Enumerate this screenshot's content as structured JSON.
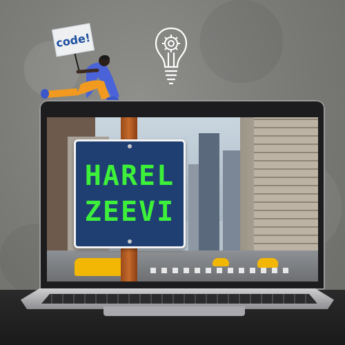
{
  "placard": {
    "text": "code!"
  },
  "sign": {
    "line1": "HAREL",
    "line2": "ZEEVI"
  },
  "colors": {
    "sign_background": "#1f3f73",
    "sign_text": "#3df03a",
    "pole": "#c46a2c",
    "taxi": "#f2b705",
    "shirt": "#4a63d8",
    "pants": "#f19a1f"
  },
  "icons": [
    "gear-icon",
    "lightbulb-icon"
  ]
}
